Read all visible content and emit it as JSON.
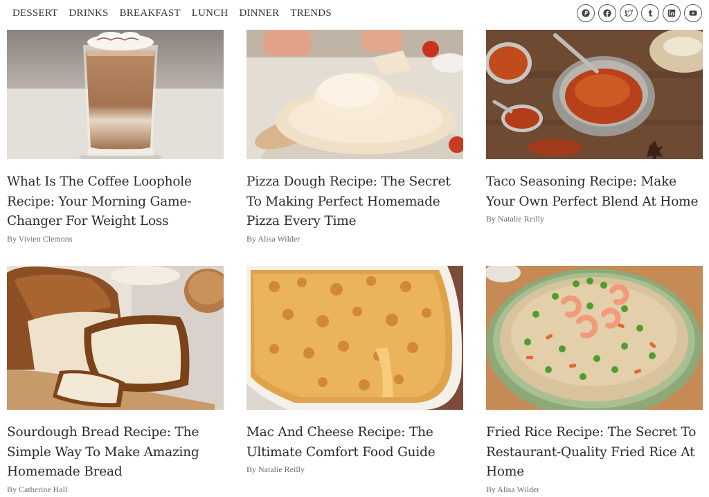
{
  "nav": {
    "items": [
      "DESSERT",
      "DRINKS",
      "BREAKFAST",
      "LUNCH",
      "DINNER",
      "TRENDS"
    ]
  },
  "social": {
    "icons": [
      "pinterest-icon",
      "facebook-icon",
      "twitter-icon",
      "tumblr-icon",
      "linkedin-icon",
      "youtube-icon"
    ]
  },
  "posts": [
    {
      "title": "What Is The Coffee Loophole Recipe: Your Morning Game-Changer For Weight Loss",
      "byline": "By Vivien Clemons",
      "image": "iced-coffee-glass"
    },
    {
      "title": "Pizza Dough Recipe: The Secret To Making Perfect Homemade Pizza Every Time",
      "byline": "By Alisa Wilder",
      "image": "pizza-dough-ball"
    },
    {
      "title": "Taco Seasoning Recipe: Make Your Own Perfect Blend At Home",
      "byline": "By Natalie Reilly",
      "image": "spice-bowl-spoons"
    },
    {
      "title": "Sourdough Bread Recipe: The Simple Way To Make Amazing Homemade Bread",
      "byline": "By Catherine Hall",
      "image": "sliced-sourdough-loaf"
    },
    {
      "title": "Mac And Cheese Recipe: The Ultimate Comfort Food Guide",
      "byline": "By Natalie Reilly",
      "image": "baked-mac-and-cheese"
    },
    {
      "title": "Fried Rice Recipe: The Secret To Restaurant-Quality Fried Rice At Home",
      "byline": "By Alisa Wilder",
      "image": "shrimp-fried-rice-bowl"
    }
  ]
}
